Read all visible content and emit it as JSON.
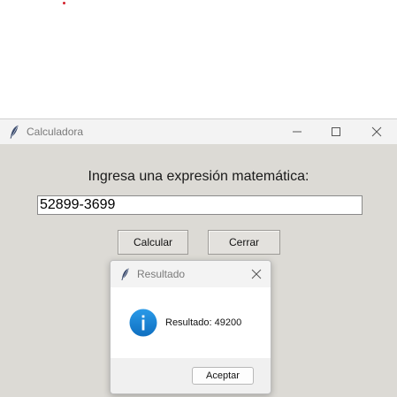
{
  "main_window": {
    "title": "Calculadora",
    "prompt": "Ingresa una expresión matemática:",
    "expression_value": "52899-3699",
    "buttons": {
      "calculate": "Calcular",
      "close": "Cerrar"
    },
    "controls": {
      "minimize_icon": "minimize-icon",
      "maximize_icon": "maximize-icon",
      "close_icon": "close-icon"
    }
  },
  "dialog": {
    "title": "Resultado",
    "message": "Resultado: 49200",
    "ok_label": "Aceptar",
    "icon": "info-icon"
  },
  "colors": {
    "window_bg": "#dcdad5",
    "info_blue": "#1a86d8",
    "marker_red": "#d3212c"
  }
}
